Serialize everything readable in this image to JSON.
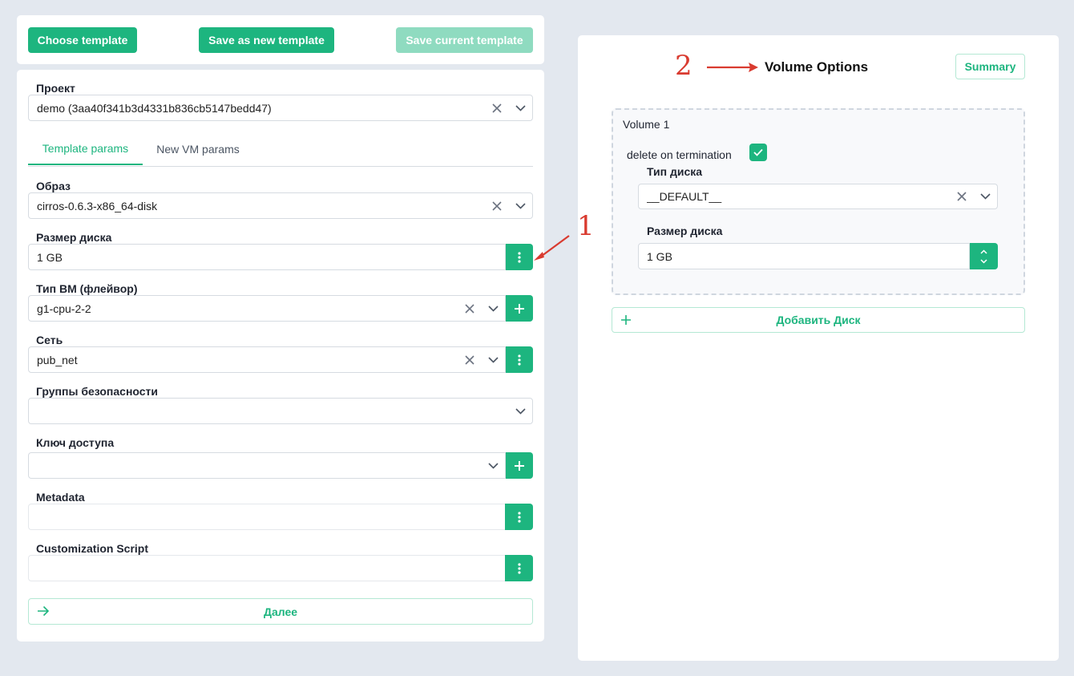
{
  "toolbar": {
    "choose_template": "Choose template",
    "save_as_new_template": "Save as new template",
    "save_current_template": "Save current template"
  },
  "form": {
    "project_label": "Проект",
    "project_value": "demo (3aa40f341b3d4331b836cb5147bedd47)",
    "tabs": [
      {
        "label": "Template params",
        "active": true
      },
      {
        "label": "New VM params",
        "active": false
      }
    ],
    "image_label": "Образ",
    "image_value": "cirros-0.6.3-x86_64-disk",
    "disk_size_label": "Размер диска",
    "disk_size_value": "1 GB",
    "flavor_label": "Тип ВМ (флейвор)",
    "flavor_value": "g1-cpu-2-2",
    "network_label": "Сеть",
    "network_value": "pub_net",
    "security_groups_label": "Группы безопасности",
    "security_groups_value": "",
    "key_label": "Ключ доступа",
    "key_value": "",
    "metadata_label": "Metadata",
    "metadata_value": "",
    "script_label": "Customization Script",
    "script_value": "",
    "next_button": "Далее"
  },
  "volume_panel": {
    "title": "Volume Options",
    "summary_button": "Summary",
    "volume_title": "Volume 1",
    "delete_on_termination_label": "delete on termination",
    "delete_on_termination_checked": true,
    "disk_type_label": "Тип диска",
    "disk_type_value": "__DEFAULT__",
    "disk_size_label": "Размер диска",
    "disk_size_value": "1 GB",
    "add_disk_button": "Добавить Диск"
  },
  "annotations": {
    "marker_1": "1",
    "marker_2": "2",
    "color": "#d93b30"
  },
  "colors": {
    "accent": "#1db57f",
    "accent_disabled": "#8fdbc0",
    "background": "#e3e8ef"
  }
}
